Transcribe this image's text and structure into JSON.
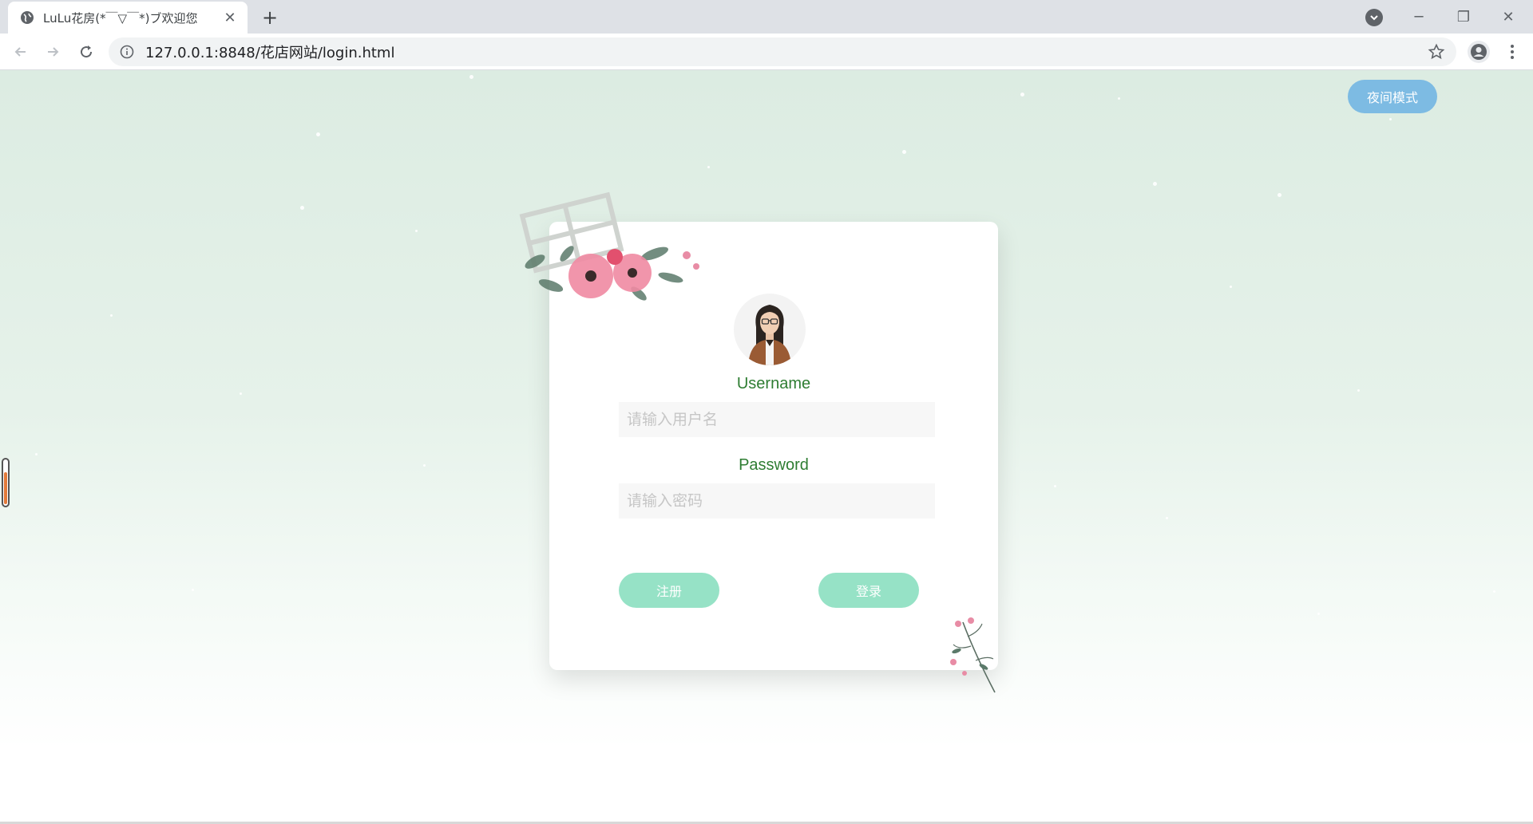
{
  "browser": {
    "tab_title": "LuLu花房(*￣▽￣*)ブ欢迎您",
    "url": "127.0.0.1:8848/花店网站/login.html"
  },
  "page": {
    "night_mode_label": "夜间模式",
    "login_form": {
      "username_label": "Username",
      "username_placeholder": "请输入用户名",
      "password_label": "Password",
      "password_placeholder": "请输入密码",
      "register_label": "注册",
      "login_label": "登录"
    }
  },
  "colors": {
    "accent_green": "#2e7d32",
    "button_mint": "#96e2c6",
    "night_button_blue": "#7dbbe3"
  }
}
